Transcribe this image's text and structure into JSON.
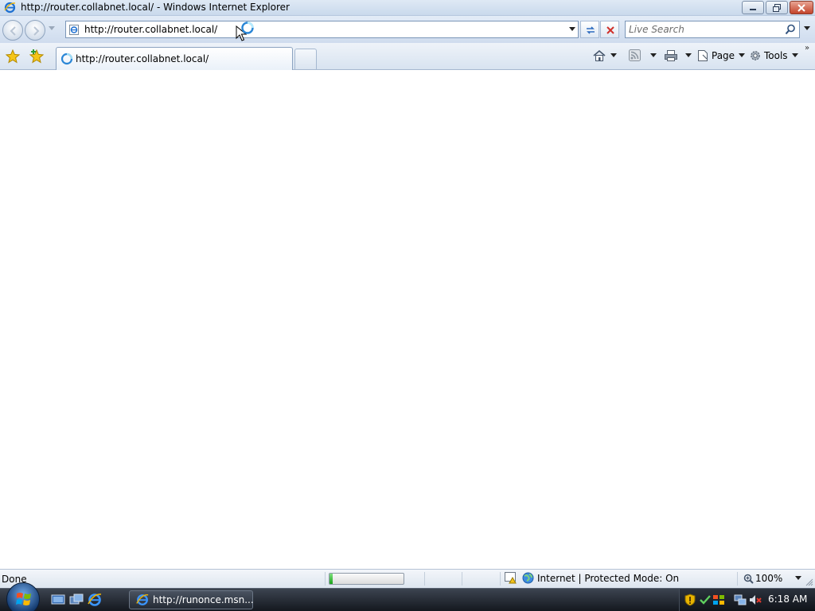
{
  "window": {
    "title": "http://router.collabnet.local/ - Windows Internet Explorer",
    "minimize_icon": "minimize-icon",
    "restore_icon": "restore-icon",
    "close_icon": "close-icon"
  },
  "navigation": {
    "back_icon": "back-arrow-icon",
    "forward_icon": "forward-arrow-icon",
    "address": "http://router.collabnet.local/",
    "search_placeholder": "Live Search"
  },
  "tabs": [
    {
      "title": "http://router.collabnet.local/",
      "state": "loading"
    }
  ],
  "command_bar": {
    "page_label": "Page",
    "tools_label": "Tools",
    "chevrons": "»"
  },
  "status_bar": {
    "status": "Done",
    "progress": 0.04,
    "zone": "Internet | Protected Mode: On",
    "zoom": "100%"
  },
  "taskbar": {
    "task_button": "http://runonce.msn...",
    "clock": "6:18 AM"
  },
  "colors": {
    "chrome_blue": "#cfdcee",
    "progress_green": "#1aa31a",
    "close_red": "#c3442b",
    "taskbar": "#14181f"
  }
}
